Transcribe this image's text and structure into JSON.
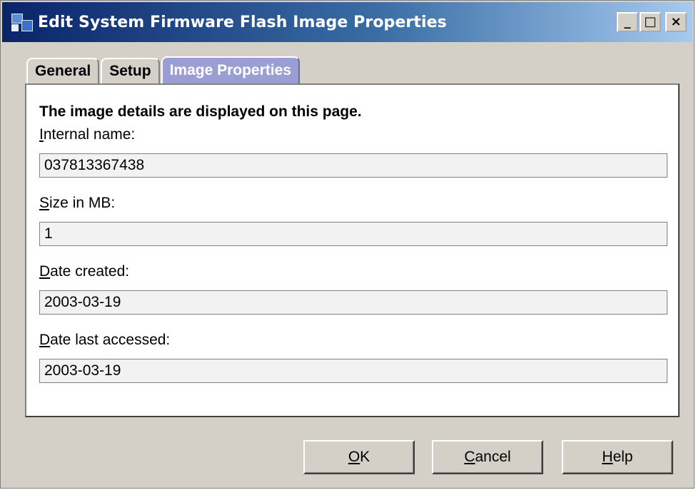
{
  "window": {
    "title": "Edit System Firmware Flash Image Properties",
    "controls": {
      "minimize": "_",
      "maximize": "□",
      "close": "×"
    }
  },
  "tabs": [
    {
      "label": "General",
      "active": false
    },
    {
      "label": "Setup",
      "active": false
    },
    {
      "label": "Image Properties",
      "active": true
    }
  ],
  "panel": {
    "heading": "The image details are displayed on this page.",
    "fields": [
      {
        "label_first": "I",
        "label_rest": "nternal name:",
        "value": "037813367438"
      },
      {
        "label_first": "S",
        "label_rest": "ize in MB:",
        "value": "1"
      },
      {
        "label_first": "D",
        "label_rest": "ate created:",
        "value": "2003-03-19"
      },
      {
        "label_first": "D",
        "label_rest": "ate last accessed:",
        "value": "2003-03-19"
      }
    ]
  },
  "buttons": {
    "ok": {
      "first": "O",
      "rest": "K"
    },
    "cancel": {
      "first": "C",
      "rest": "ancel"
    },
    "help": {
      "first": "H",
      "rest": "elp"
    }
  },
  "colors": {
    "titlebar_start": "#0a246a",
    "titlebar_end": "#a6caf0",
    "active_tab": "#9b9ed2",
    "dialog_face": "#d4d0c8"
  },
  "icons": {
    "app": "app-icon",
    "minimize": "minimize-icon",
    "maximize": "maximize-icon",
    "close": "close-icon"
  }
}
